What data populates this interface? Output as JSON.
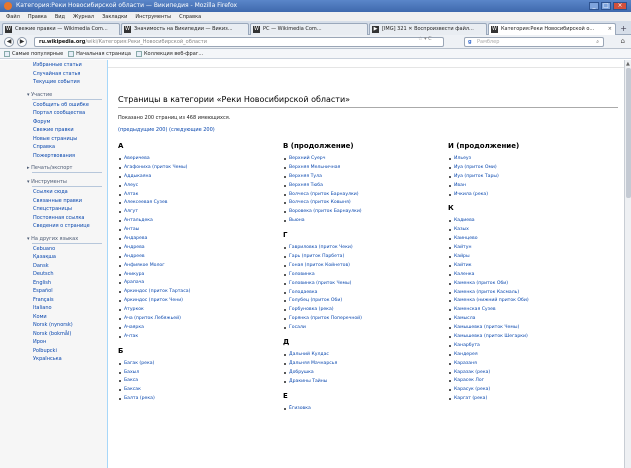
{
  "window": {
    "title": "Категория:Реки Новосибирской области — Википедия - Mozilla Firefox",
    "min": "_",
    "max": "□",
    "close": "×"
  },
  "menu": [
    "Файл",
    "Правка",
    "Вид",
    "Журнал",
    "Закладки",
    "Инструменты",
    "Справка"
  ],
  "tabs": [
    {
      "label": "Свежие правки — Wikimedia Com...",
      "icon": "W",
      "active": false
    },
    {
      "label": "Значимость на Википедии — Викиз...",
      "icon": "W",
      "active": false
    },
    {
      "label": "PC — Wikimedia Com...",
      "icon": "W",
      "active": false
    },
    {
      "label": "[IMG] 321 ✕ Воспроизвести файл...",
      "icon": "▶",
      "active": false
    },
    {
      "label": "Категория:Реки Новосибирской о...",
      "icon": "W",
      "active": true
    }
  ],
  "tab_new": "+",
  "nav": {
    "back": "◀",
    "forward": "▶",
    "url_domain": "ru.wikipedia.org",
    "url_path": "/wiki/Категория:Реки_Новосибирской_области",
    "url_icons": "☆ ▾ C",
    "search_placeholder": "Рамблер",
    "search_engine": "g",
    "search_glass": "⌕",
    "home": "⌂"
  },
  "bookmarks": [
    "Самые популярные",
    "Начальная страница",
    "Коллекция веб-фраг..."
  ],
  "sidebar": {
    "links_top": [
      "Избранные статьи",
      "Случайная статья",
      "Текущие события"
    ],
    "sections": [
      {
        "head": "▾ Участие",
        "items": [
          "Сообщить об ошибке",
          "Портал сообщества",
          "Форум",
          "Свежие правки",
          "Новые страницы",
          "Справка",
          "Пожертвования"
        ]
      },
      {
        "head": "▸ Печать/экспорт",
        "items": []
      },
      {
        "head": "▾ Инструменты",
        "items": [
          "Ссылки сюда",
          "Связанные правки",
          "Спецстраницы",
          "Постоянная ссылка",
          "Сведения о странице"
        ]
      },
      {
        "head": "▾ На других языках",
        "items": [
          "Cebuano",
          "Қазақша",
          "Dansk",
          "Deutsch",
          "English",
          "Español",
          "Français",
          "Italiano",
          "Кoми",
          "Norsk (nynorsk)",
          "Norsk (bokmål)",
          "Ирон",
          "Polbupcki",
          "Українська"
        ]
      }
    ]
  },
  "page": {
    "title": "Страницы в категории «Реки Новосибирской области»",
    "count": "Показано 200 страниц из 468 имеющихся.",
    "prev": "(предыдущие 200)",
    "next": "(следующие 200)"
  },
  "columns": [
    {
      "groups": [
        {
          "letter": "А",
          "items": [
            "Аверичева",
            "Агафонихa (приток Чемы)",
            "Аддыкаяна",
            "Алеус",
            "Алтак",
            "Алексеевая Сузев",
            "Алгут",
            "Антальдека",
            "Антаы",
            "Андарева",
            "Андрева",
            "Андреев",
            "Анфиякое Молог",
            "Аникура",
            "Арапача",
            "Аркиндос (приток Тартаса)",
            "Аркиндос (приток Чени)",
            "Атуркок",
            "Ача (приток Лебяжьей)",
            "Ачаярка",
            "Ачтак"
          ]
        },
        {
          "letter": "Б",
          "items": [
            "Багак (река)",
            "Бахыл",
            "Бакса",
            "Баксак",
            "Балта (река)"
          ]
        }
      ]
    },
    {
      "groups": [
        {
          "letter": "В (продолжение)",
          "items": [
            "Верхний Суерч",
            "Верхняя Мельничная",
            "Верхняя Тула",
            "Верхняя Тюба",
            "Волчеса (приток Барнаулки)",
            "Волчеса (приток Ковыня)",
            "Воровека (приток Барнаулки)",
            "Вьюна"
          ]
        },
        {
          "letter": "Г",
          "items": [
            "Гавриловка (приток Чеки)",
            "Гарь (приток Парбета)",
            "Гоная (приток Койнетов)",
            "Головинка",
            "Головинка (приток Чемы)",
            "Голодаевка",
            "Голубец (приток Оби)",
            "Горбуновка (река)",
            "Горянка (приток Поперечной)",
            "Госали"
          ]
        },
        {
          "letter": "Д",
          "items": [
            "Дальний Кулдас",
            "Дальняя Мачнарсья",
            "Добрушка",
            "Дракины Тайны"
          ]
        },
        {
          "letter": "Е",
          "items": [
            "Ёгизовка"
          ]
        }
      ]
    },
    {
      "groups": [
        {
          "letter": "И (продолжение)",
          "items": [
            "Ильеуз",
            "Иуа (приток Оми)",
            "Иуа (приток Тары)",
            "Иван",
            "Ичкила (река)"
          ]
        },
        {
          "letter": "К",
          "items": [
            "Кадиева",
            "Казых",
            "Каинцево",
            "Кайтун",
            "Кайры",
            "Кайтик",
            "Каленка",
            "Каменка (приток Оби)",
            "Каменка (приток Касмаль)",
            "Каменка (нижний приток Оби)",
            "Каменская Сузев",
            "Камысла",
            "Камышевка (приток Чемы)",
            "Камышевка (приток Шегарки)",
            "Канарбута",
            "Кандерея",
            "Каразаня",
            "Каразак (река)",
            "Карасек Лог",
            "Карасук (река)",
            "Каргат (река)"
          ]
        }
      ]
    }
  ]
}
